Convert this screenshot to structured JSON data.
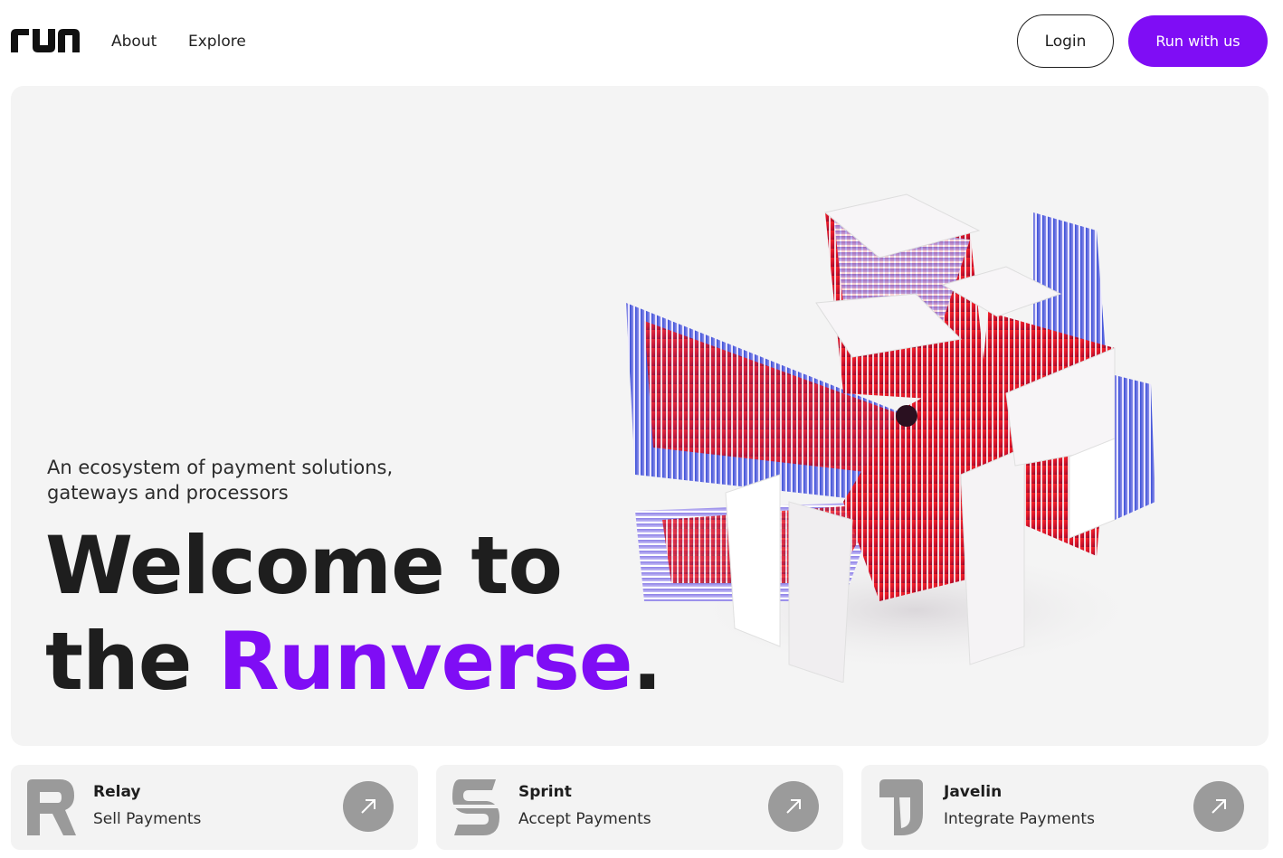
{
  "header": {
    "logo_text": "run",
    "nav": [
      {
        "label": "About"
      },
      {
        "label": "Explore"
      }
    ],
    "login_label": "Login",
    "cta_label": "Run with us"
  },
  "hero": {
    "subtitle": "An ecosystem of payment solutions, gateways and processors",
    "title_line1": "Welcome to",
    "title_line2_prefix": "the ",
    "title_line2_accent": "Runverse",
    "title_line2_suffix": "."
  },
  "products": [
    {
      "name": "Relay",
      "description": "Sell Payments",
      "icon": "relay-glyph-icon"
    },
    {
      "name": "Sprint",
      "description": "Accept Payments",
      "icon": "sprint-glyph-icon"
    },
    {
      "name": "Javelin",
      "description": "Integrate Payments",
      "icon": "javelin-glyph-icon"
    }
  ],
  "colors": {
    "accent": "#7f0df5",
    "hero_background": "#f4f4f4",
    "card_background": "#f3f3f3",
    "arrow_button": "#9b9b9b"
  }
}
